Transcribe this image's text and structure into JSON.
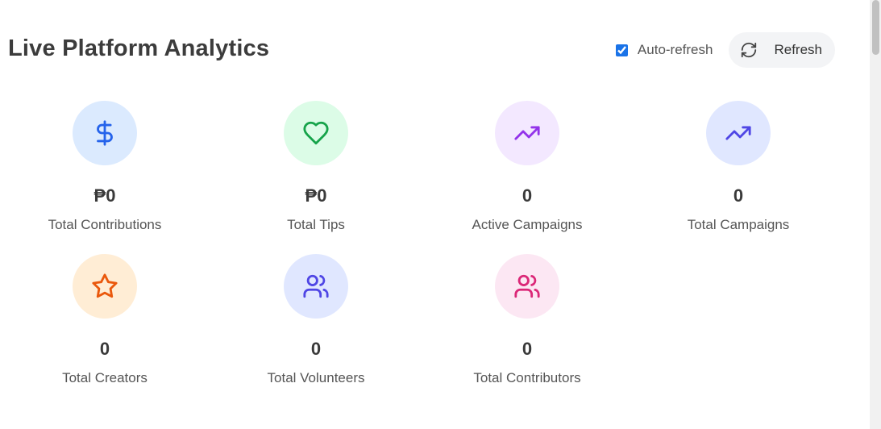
{
  "header": {
    "title": "Live Platform Analytics",
    "auto_refresh_label": "Auto-refresh",
    "auto_refresh_checked": true,
    "refresh_label": "Refresh"
  },
  "stats": [
    {
      "value": "₱0",
      "label": "Total Contributions",
      "icon": "dollar-icon",
      "color": "#2563eb",
      "bg": "#dbeafe"
    },
    {
      "value": "₱0",
      "label": "Total Tips",
      "icon": "heart-icon",
      "color": "#16a34a",
      "bg": "#dcfce7"
    },
    {
      "value": "0",
      "label": "Active Campaigns",
      "icon": "trending-up-icon",
      "color": "#9333ea",
      "bg": "#f3e8ff"
    },
    {
      "value": "0",
      "label": "Total Campaigns",
      "icon": "trending-up-icon",
      "color": "#4f46e5",
      "bg": "#e0e7ff"
    },
    {
      "value": "0",
      "label": "Total Creators",
      "icon": "star-icon",
      "color": "#ea580c",
      "bg": "#ffedd5"
    },
    {
      "value": "0",
      "label": "Total Volunteers",
      "icon": "users-icon",
      "color": "#4f46e5",
      "bg": "#e0e7ff"
    },
    {
      "value": "0",
      "label": "Total Contributors",
      "icon": "users-icon",
      "color": "#db2777",
      "bg": "#fce7f3"
    }
  ]
}
